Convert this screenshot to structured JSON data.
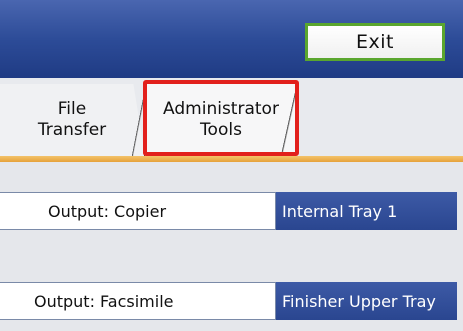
{
  "header": {
    "exit_label": "Exit"
  },
  "tabs": [
    {
      "line1": "File",
      "line2": "Transfer"
    },
    {
      "line1": "Administrator",
      "line2": "Tools"
    }
  ],
  "settings": [
    {
      "label": "Output: Copier",
      "value": "Internal Tray 1"
    },
    {
      "label": "Output: Facsimile",
      "value": "Finisher Upper Tray"
    }
  ],
  "colors": {
    "header_blue": "#2d4c98",
    "exit_border_green": "#5aa62e",
    "highlight_red": "#e2201c",
    "accent_gold": "#e6a23a",
    "value_blue": "#2a4690"
  }
}
